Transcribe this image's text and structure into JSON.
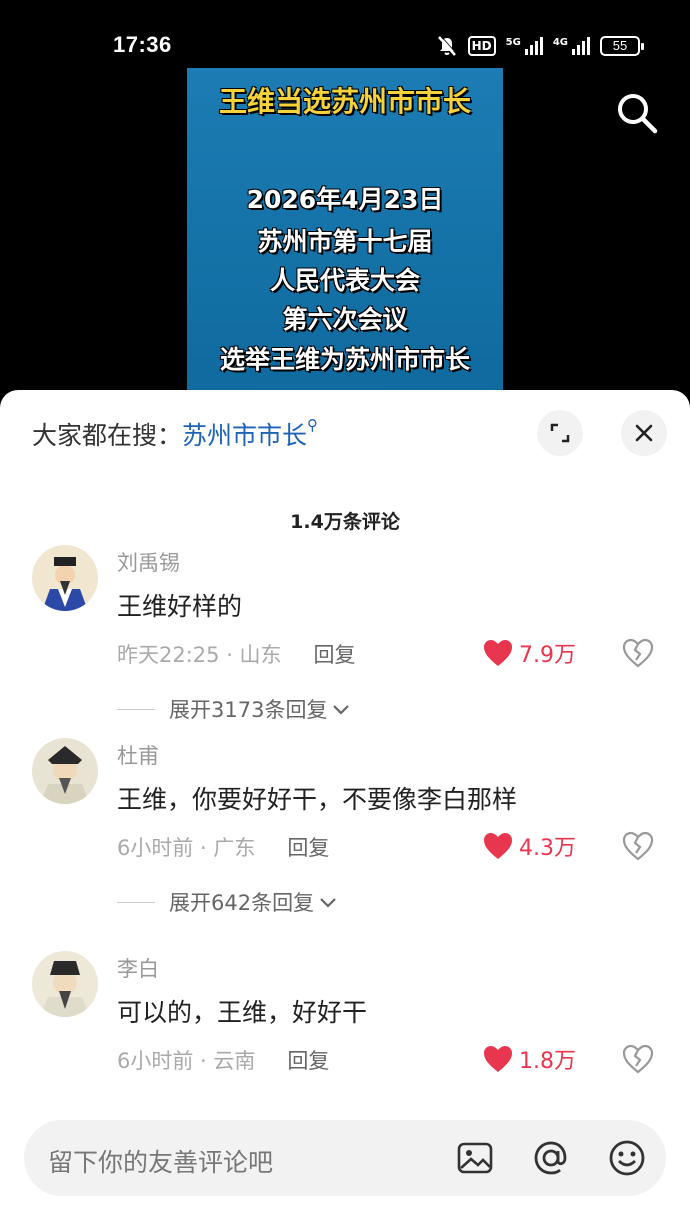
{
  "status_bar": {
    "time": "17:36",
    "hd": "HD",
    "net1": "5G",
    "net2": "4G",
    "battery": "55"
  },
  "video": {
    "title": "王维当选苏州市市长",
    "lines": [
      "2026年4月23日",
      "苏州市第十七届",
      "人民代表大会",
      "第六次会议",
      "选举王维为苏州市市长"
    ]
  },
  "search_bar": {
    "label": "大家都在搜：",
    "term": "苏州市市长"
  },
  "comment_count": "1.4万条评论",
  "comments": [
    {
      "user": "刘禹锡",
      "text": "王维好样的",
      "time_loc": "昨天22:25 · 山东",
      "reply": "回复",
      "likes": "7.9万",
      "expand": "展开3173条回复"
    },
    {
      "user": "杜甫",
      "text": "王维，你要好好干，不要像李白那样",
      "time_loc": "6小时前 · 广东",
      "reply": "回复",
      "likes": "4.3万",
      "expand": "展开642条回复"
    },
    {
      "user": "李白",
      "text": "可以的，王维，好好干",
      "time_loc": "6小时前 · 云南",
      "reply": "回复",
      "likes": "1.8万"
    }
  ],
  "input": {
    "placeholder": "留下你的友善评论吧"
  },
  "colors": {
    "like": "#e8364f",
    "link": "#1e63b8",
    "video_bg": "#1c7cb3",
    "video_title": "#f5d33a"
  },
  "icons": [
    "mute-icon",
    "signal-icon",
    "battery-icon",
    "search-icon",
    "expand-icon",
    "close-icon",
    "heart-icon",
    "broken-heart-icon",
    "chevron-down-icon",
    "image-icon",
    "at-icon",
    "emoji-icon"
  ]
}
